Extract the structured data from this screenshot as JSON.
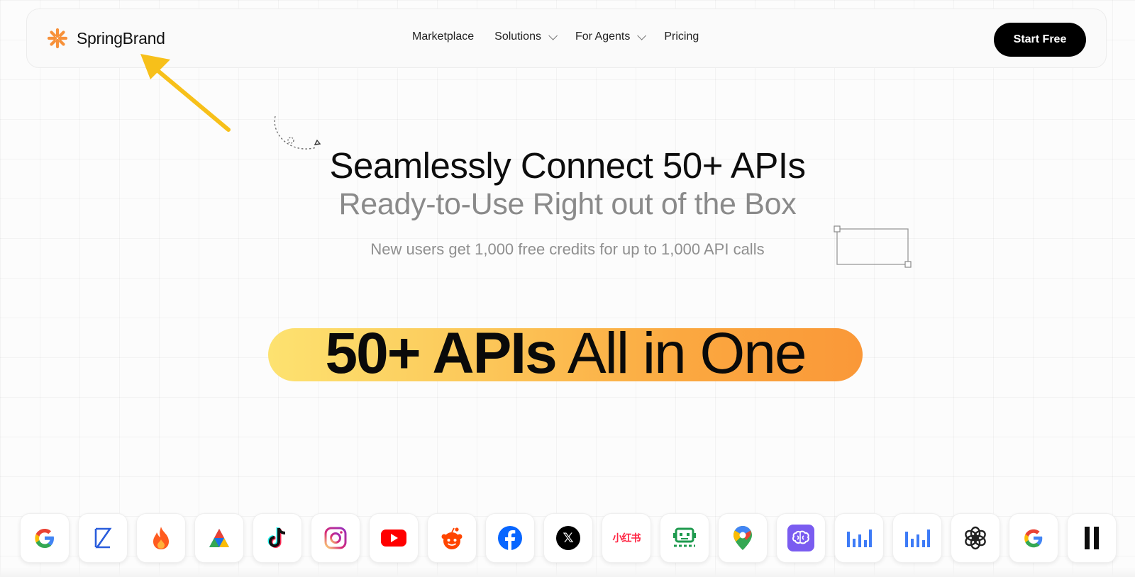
{
  "nav": {
    "brand": "SpringBrand",
    "links": [
      {
        "label": "Marketplace"
      },
      {
        "label": "Solutions"
      },
      {
        "label": "For Agents"
      },
      {
        "label": "Pricing"
      }
    ],
    "cta": "Start Free"
  },
  "hero": {
    "title": "Seamlessly Connect 50+ APIs",
    "subtitle": "Ready-to-Use Right out of the Box",
    "note": "New users get 1,000 free credits for up to 1,000 API calls",
    "highlight_bold": "50+ APIs",
    "highlight_rest": " All in One"
  },
  "logos": [
    {
      "icon": "google-icon"
    },
    {
      "icon": "kaggle-icon"
    },
    {
      "icon": "flame-icon"
    },
    {
      "icon": "adroll-icon"
    },
    {
      "icon": "tiktok-icon"
    },
    {
      "icon": "instagram-icon"
    },
    {
      "icon": "youtube-icon"
    },
    {
      "icon": "reddit-icon"
    },
    {
      "icon": "facebook-icon"
    },
    {
      "icon": "x-icon",
      "text": "𝕏"
    },
    {
      "icon": "xiaohongshu-icon",
      "text": "小红书"
    },
    {
      "icon": "robot-icon"
    },
    {
      "icon": "google-maps-icon"
    },
    {
      "icon": "brain-icon"
    },
    {
      "icon": "bar-chart-icon"
    },
    {
      "icon": "bar-chart-icon"
    },
    {
      "icon": "openai-icon"
    },
    {
      "icon": "google-icon"
    },
    {
      "icon": "pause-icon"
    }
  ],
  "colors": {
    "brand_orange": "#f7913a",
    "highlight_start": "#fde270",
    "highlight_end": "#fa9838",
    "arrow_yellow": "#f7c01a"
  }
}
